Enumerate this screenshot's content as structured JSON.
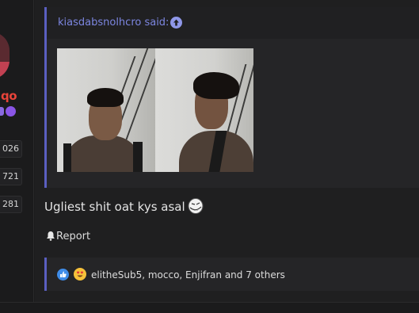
{
  "user": {
    "name_fragment": "qo",
    "stats": [
      "026",
      "721",
      "281"
    ]
  },
  "quote": {
    "author_label": "kiasdabsnolhcro said:",
    "icons": [
      "arrow-up-circle-icon"
    ]
  },
  "post": {
    "message": "Ugliest shit oat kys asal",
    "report_label": "Report"
  },
  "reactions": {
    "text": "elitheSub5, mocco, Enjifran and 7 others",
    "icons": [
      "like-icon",
      "heart-eyes-icon"
    ]
  },
  "colors": {
    "accent": "#5a5fc0",
    "link": "#7c86e0",
    "username": "#e8443a",
    "background": "#1b1b1c"
  }
}
